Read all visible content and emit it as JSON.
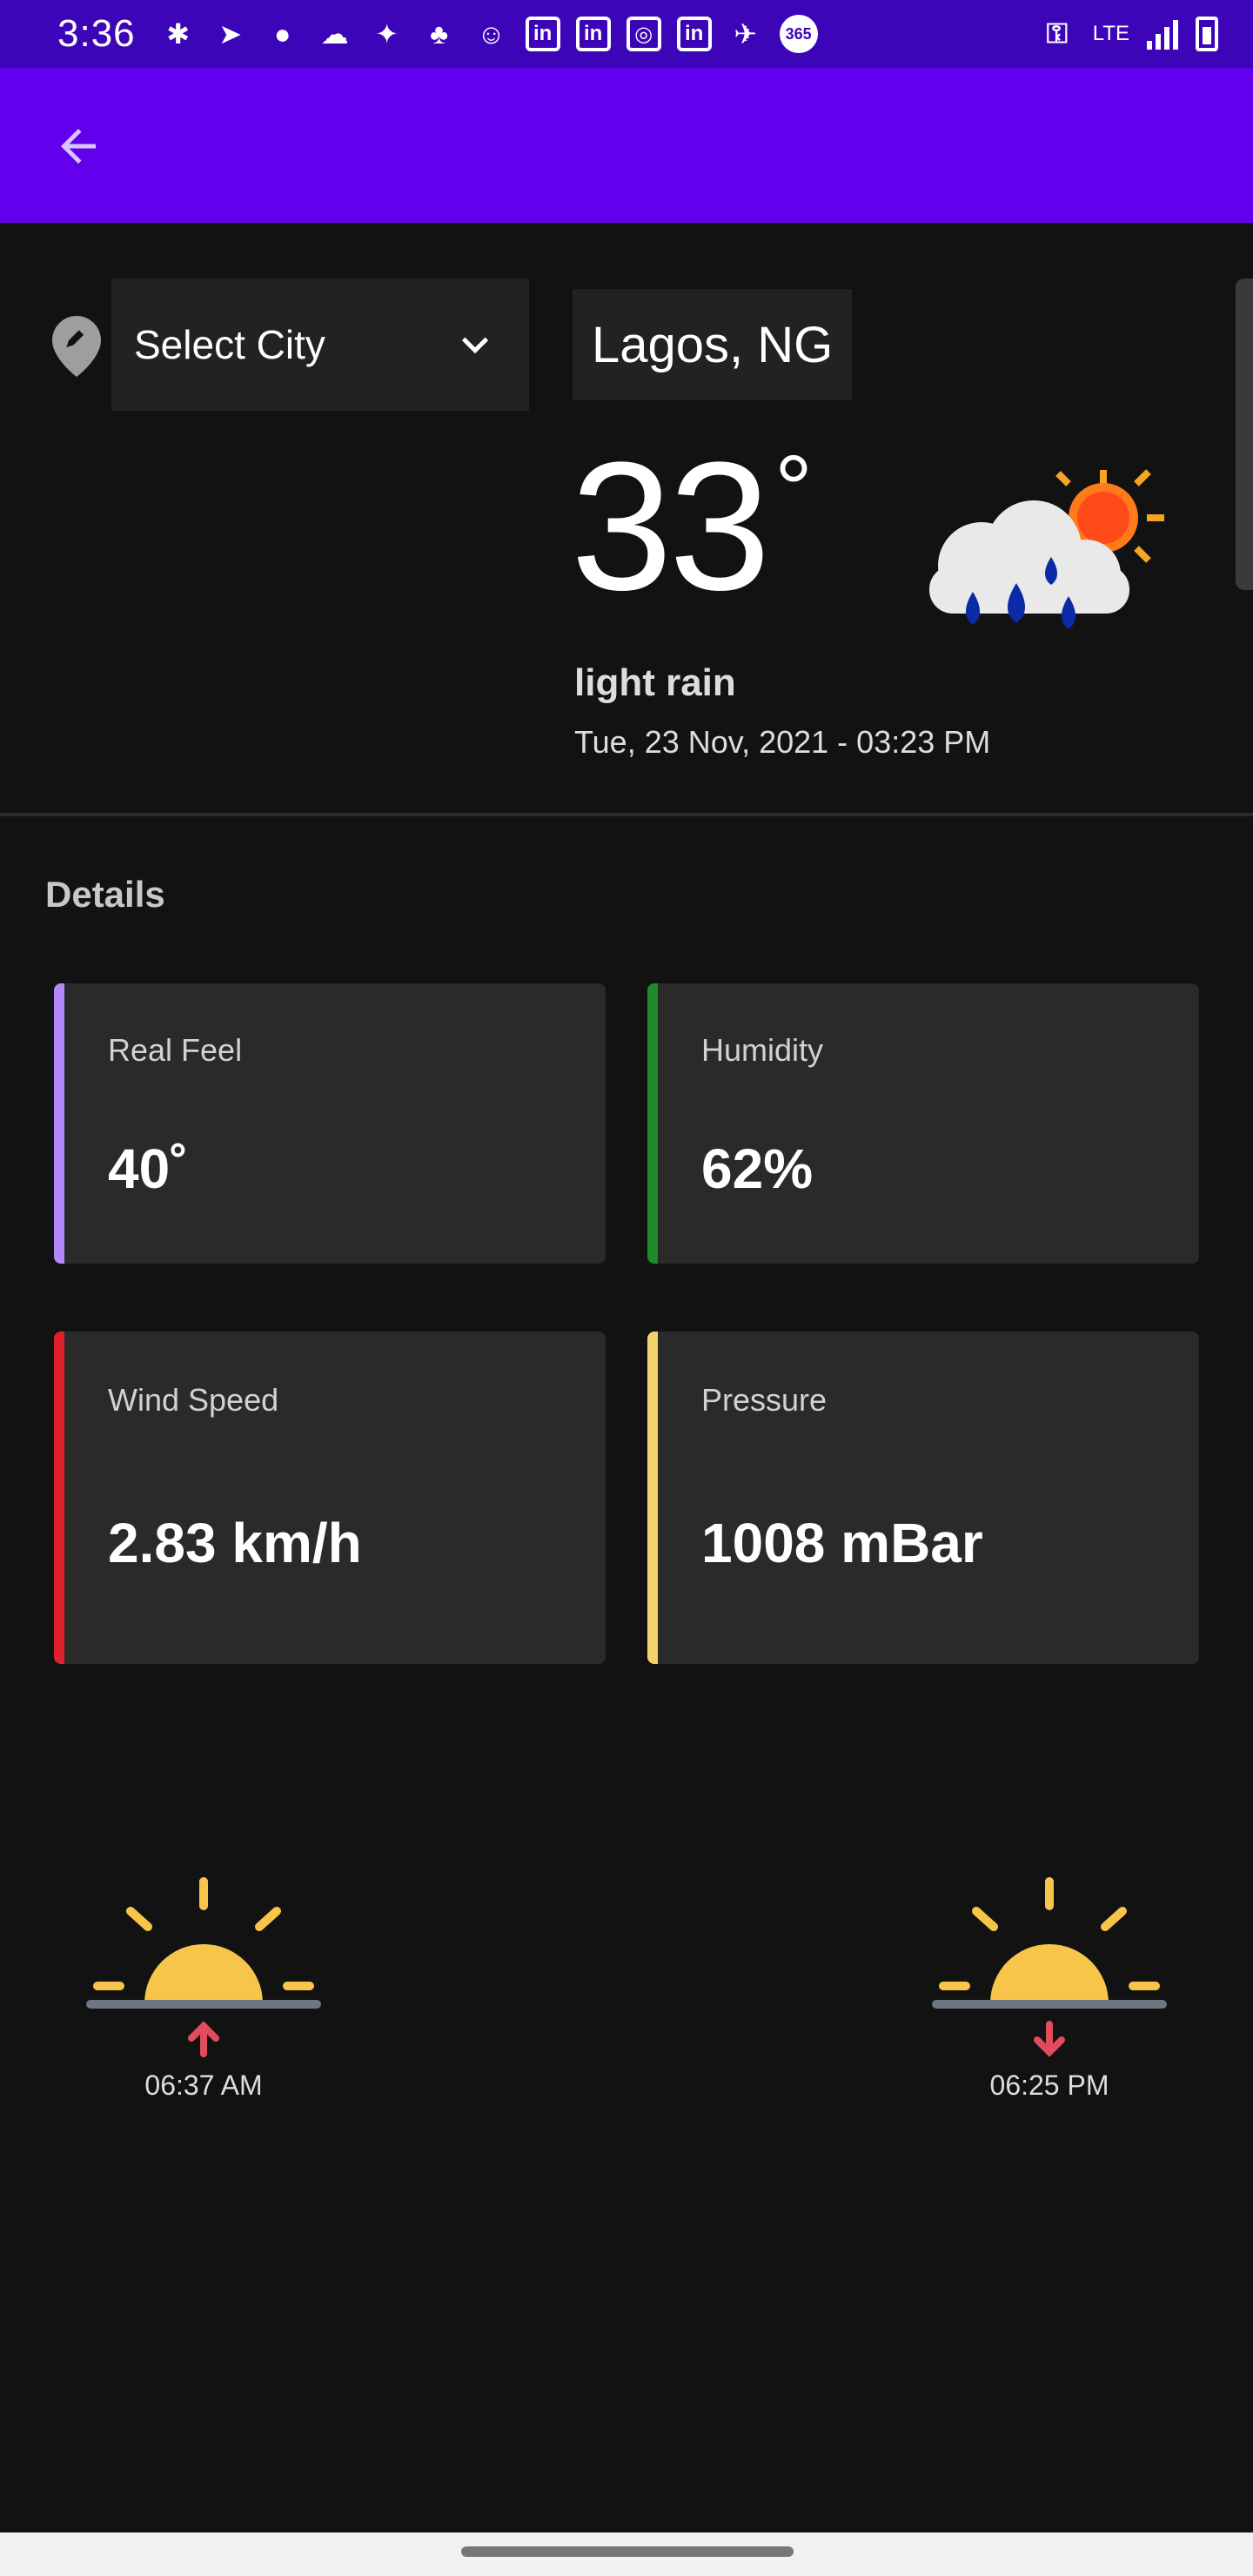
{
  "status_bar": {
    "time": "3:36",
    "lte_label": "LTE",
    "icons": [
      "slack-icon",
      "telegram-icon",
      "fire-icon",
      "chat-icon",
      "twitter-icon",
      "app-icon",
      "person-add-icon",
      "linkedin-icon",
      "linkedin-icon",
      "instagram-icon",
      "linkedin-icon",
      "rocket-icon",
      "365-icon"
    ],
    "linkedin_text": "in",
    "badge_text": "365"
  },
  "app_bar": {
    "back_icon": "arrow-left-icon",
    "color": "#6200ee"
  },
  "location": {
    "select_label": "Select City",
    "city": "Lagos, NG"
  },
  "current": {
    "temperature": "33",
    "unit": "°",
    "condition": "light rain",
    "datetime": "Tue, 23 Nov, 2021 - 03:23 PM",
    "icon": "rain-cloud-sun-icon"
  },
  "details": {
    "title": "Details",
    "cards": [
      {
        "label": "Real Feel",
        "value": "40˚",
        "accent": "#b388ff"
      },
      {
        "label": "Humidity",
        "value": "62%",
        "accent": "#1f8a2a"
      },
      {
        "label": "Wind Speed",
        "value": "2.83 km/h",
        "accent": "#e0202a"
      },
      {
        "label": "Pressure",
        "value": "1008 mBar",
        "accent": "#f3d36b"
      }
    ]
  },
  "sun": {
    "sunrise": "06:37 AM",
    "sunset": "06:25 PM"
  }
}
